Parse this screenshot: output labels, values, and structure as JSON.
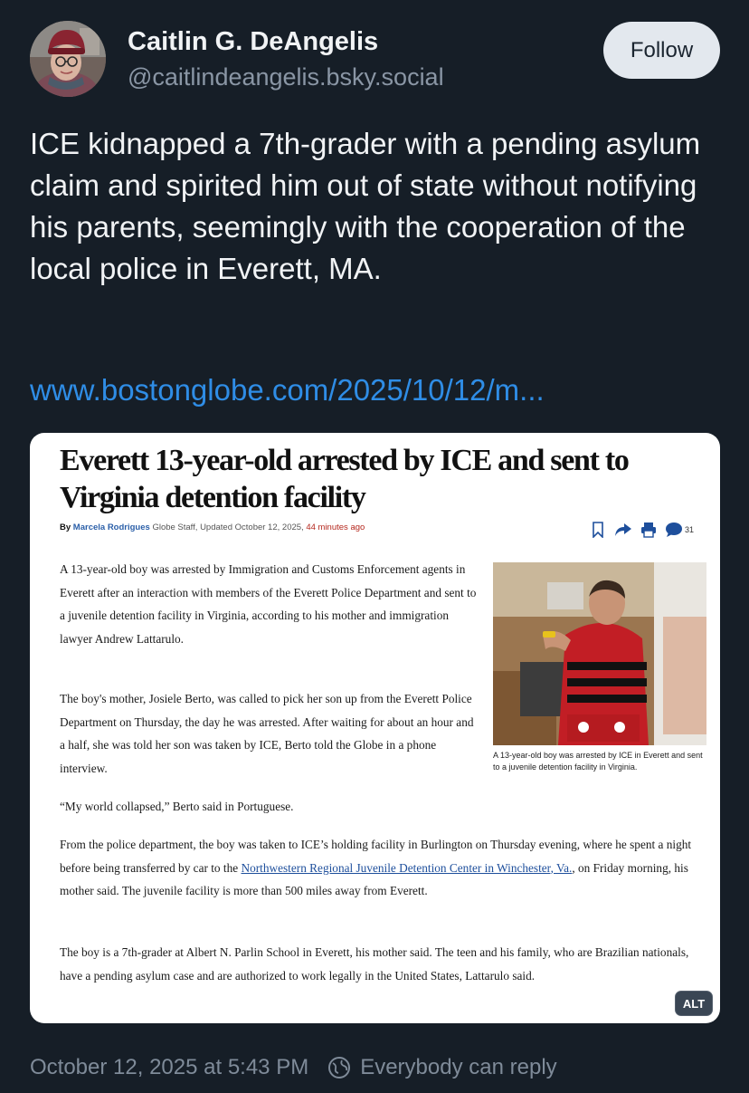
{
  "author": {
    "name": "Caitlin G. DeAngelis",
    "handle": "@caitlindeangelis.bsky.social"
  },
  "follow_label": "Follow",
  "post": {
    "text": "ICE kidnapped a 7th-grader with a pending asylum claim and spirited him out of state without notifying his parents, seemingly with the cooperation of the local police in Everett, MA.",
    "link": "www.bostonglobe.com/2025/10/12/m..."
  },
  "article": {
    "headline": "Everett 13-year-old arrested by ICE and sent to Virginia detention facility",
    "byline": {
      "by": "By",
      "author": "Marcela Rodrigues",
      "staff": "Globe Staff, Updated October 12, 2025,",
      "time": "44 minutes ago"
    },
    "comment_count": "31",
    "paragraphs": {
      "p1": "A 13-year-old boy was arrested by Immigration and Customs Enforcement agents in Everett after an interaction with members of the Everett Police Department and sent to a juvenile detention facility in Virginia, according to his mother and immigration lawyer Andrew Lattarulo.",
      "p2": "The boy's mother, Josiele Berto, was called to pick her son up from the Everett Police Department on Thursday, the day he was arrested. After waiting for about an hour and a half, she was told her son was taken by ICE, Berto told the Globe in a phone interview.",
      "p3": "“My world collapsed,” Berto said in Portuguese.",
      "p4_before": "From the police department, the boy was taken to ICE’s holding facility in Burlington on Thursday evening, where he spent a night before being transferred by car to the",
      "p4_link": "Northwestern Regional Juvenile Detention Center in Winchester, Va.",
      "p4_after": ", on Friday morning, his mother said. The juvenile facility is more than 500 miles away from Everett.",
      "p5": "The boy is a 7th-grader at Albert N. Parlin School in Everett, his mother said. The teen and his family, who are Brazilian nationals, have a pending asylum case and are authorized to work legally in the United States, Lattarulo said."
    },
    "photo_caption": "A 13-year-old boy was arrested by ICE in Everett and sent to a juvenile detention facility in Virginia."
  },
  "alt_label": "ALT",
  "meta": {
    "timestamp": "October 12, 2025 at 5:43 PM",
    "reply_setting": "Everybody can reply"
  },
  "icons": [
    "bookmark-icon",
    "share-icon",
    "print-icon",
    "comment-icon",
    "globe-icon"
  ],
  "colors": {
    "background": "#161e27",
    "link": "#2f8de6",
    "muted": "#8a96a5",
    "follow_bg": "#e3e8ee"
  }
}
